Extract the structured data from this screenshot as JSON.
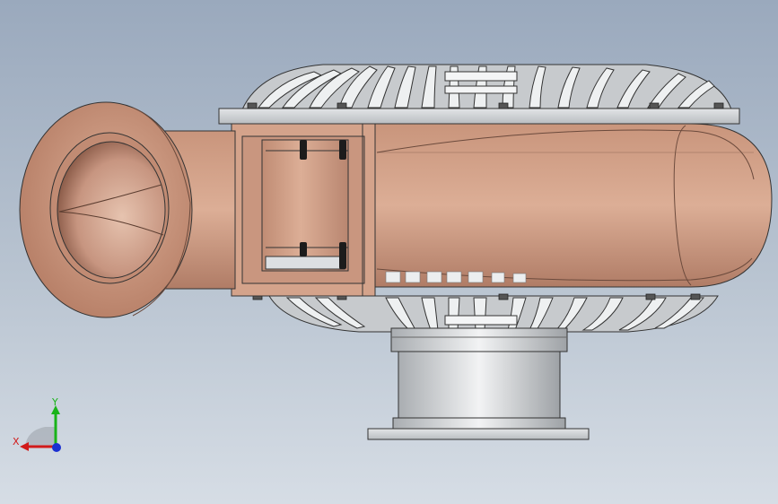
{
  "viewport": {
    "colors": {
      "background_top": "#9aa9bd",
      "background_bottom": "#d6dde5",
      "copper": "#d2a28a",
      "steel": "#d9dde0"
    }
  },
  "triad": {
    "x_label": "X",
    "y_label": "Y",
    "colors": {
      "x": "#d11a1a",
      "y": "#19b319",
      "z": "#1a2fd1"
    }
  }
}
